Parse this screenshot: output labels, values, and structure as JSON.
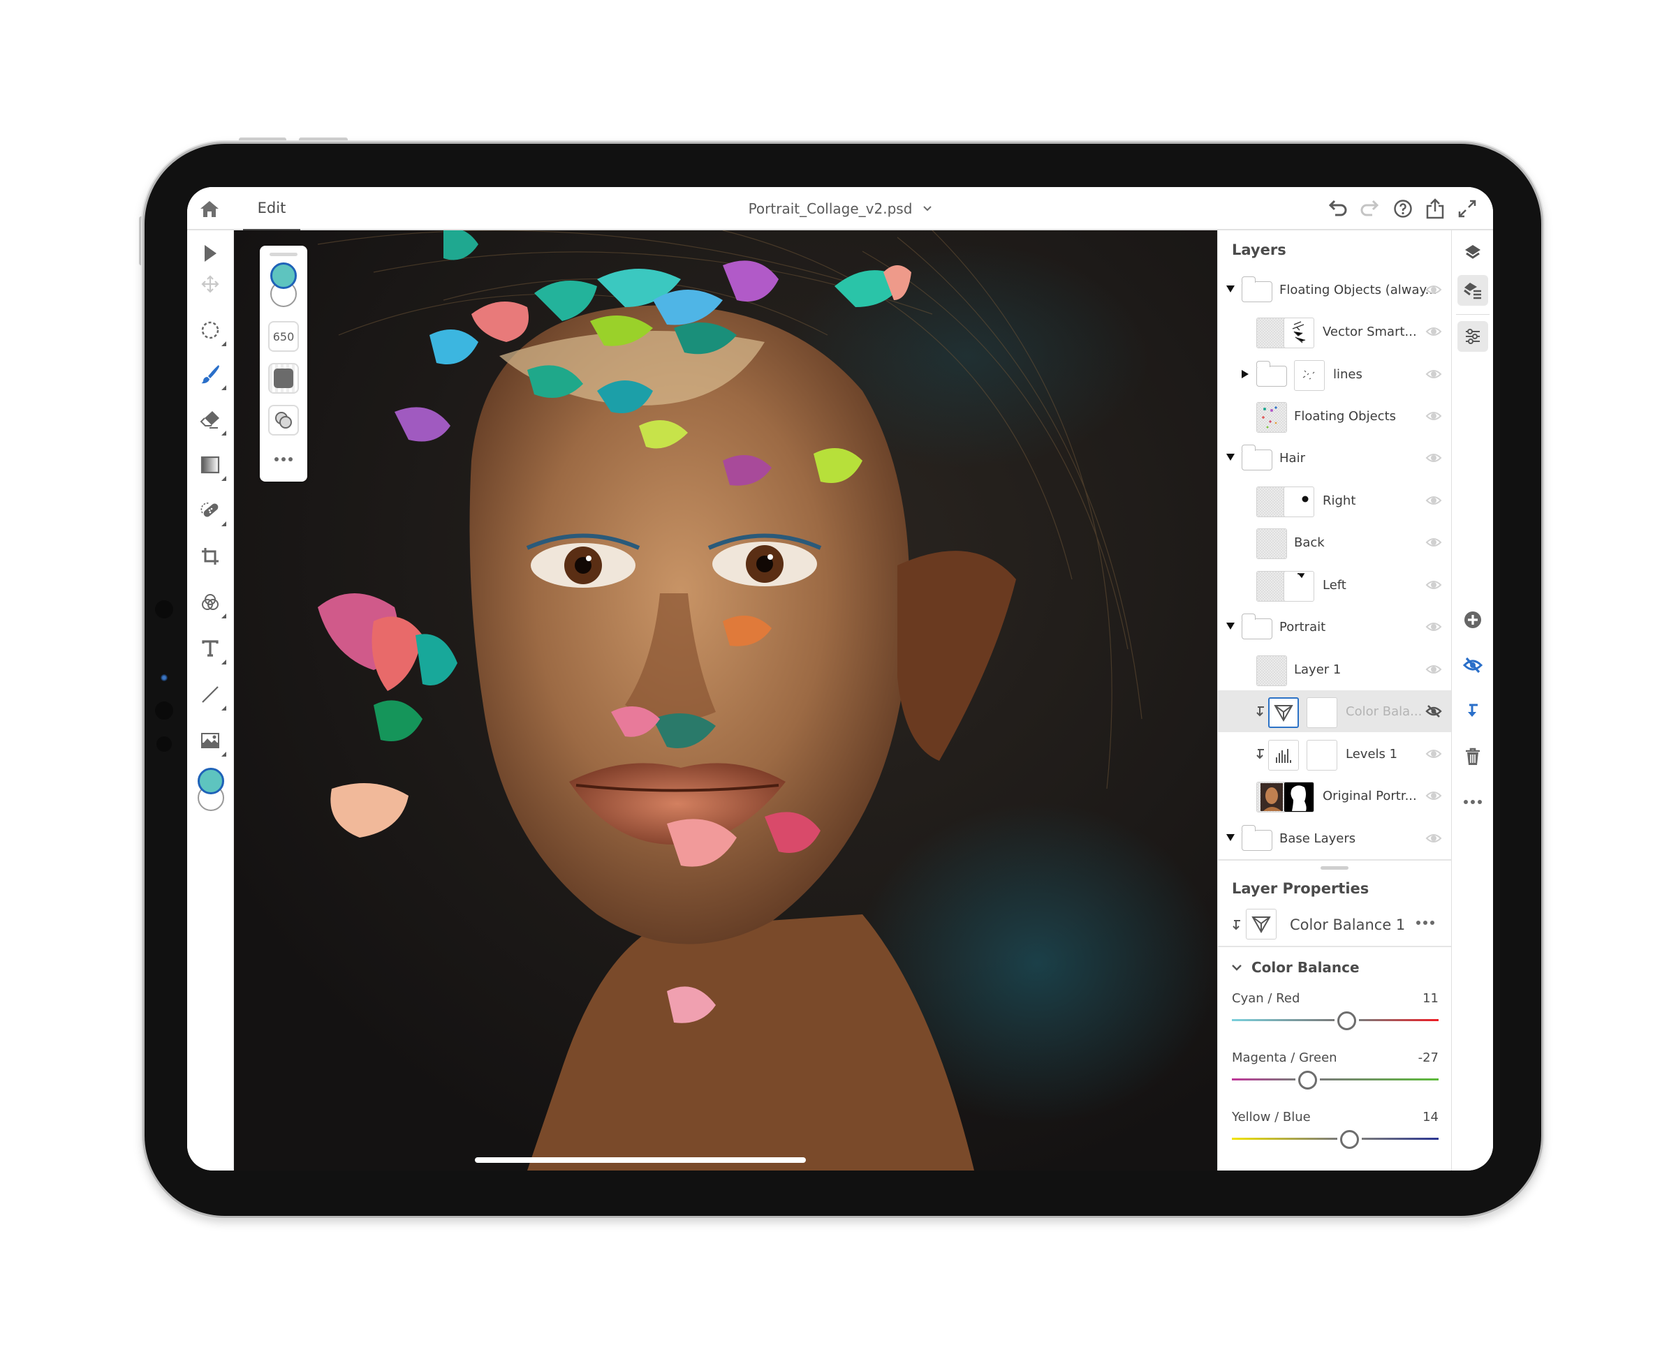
{
  "header": {
    "home_icon": "home-icon",
    "tab_label": "Edit",
    "document_title": "Portrait_Collage_v2.psd",
    "actions": [
      "undo-icon",
      "redo-icon",
      "help-icon",
      "share-icon",
      "fullscreen-icon"
    ]
  },
  "toolbar": {
    "tools": [
      {
        "name": "select",
        "icon": "arrow-pointer-icon"
      },
      {
        "name": "move",
        "icon": "move-icon"
      },
      {
        "name": "lasso-select",
        "icon": "dashed-circle-icon"
      },
      {
        "name": "brush",
        "icon": "brush-icon",
        "active": true
      },
      {
        "name": "eraser",
        "icon": "eraser-icon"
      },
      {
        "name": "gradient",
        "icon": "gradient-icon"
      },
      {
        "name": "healing",
        "icon": "bandage-icon"
      },
      {
        "name": "crop",
        "icon": "crop-icon"
      },
      {
        "name": "adjustments",
        "icon": "color-circles-icon"
      },
      {
        "name": "type",
        "icon": "type-icon"
      },
      {
        "name": "line",
        "icon": "line-icon"
      },
      {
        "name": "place-image",
        "icon": "image-icon"
      }
    ],
    "foreground_color": "#5ec4bf",
    "background_color": "#ffffff"
  },
  "tool_options": {
    "foreground_color": "#5ec4bf",
    "brush_size": "650",
    "brush_hardness_icon": "brush-tip-icon",
    "blend_icon": "blend-circles-icon",
    "more_icon": "more-icon"
  },
  "layers_panel": {
    "title": "Layers",
    "layers": [
      {
        "name": "Floating Objects (alway...",
        "type": "group",
        "expanded": true,
        "depth": 0,
        "visible": true
      },
      {
        "name": "Vector Smart...",
        "type": "smart-object",
        "depth": 1,
        "visible": true
      },
      {
        "name": "lines",
        "type": "group",
        "expanded": false,
        "depth": 1,
        "visible": true
      },
      {
        "name": "Floating Objects",
        "type": "pixel",
        "depth": 1,
        "visible": true
      },
      {
        "name": "Hair",
        "type": "group",
        "expanded": true,
        "depth": 0,
        "visible": true
      },
      {
        "name": "Right",
        "type": "pixel-with-mask",
        "depth": 1,
        "visible": true
      },
      {
        "name": "Back",
        "type": "pixel",
        "depth": 1,
        "visible": true
      },
      {
        "name": "Left",
        "type": "pixel-with-mask",
        "depth": 1,
        "visible": true
      },
      {
        "name": "Portrait",
        "type": "group",
        "expanded": true,
        "depth": 0,
        "visible": true
      },
      {
        "name": "Layer 1",
        "type": "pixel",
        "depth": 1,
        "visible": true
      },
      {
        "name": "Color Bala...",
        "type": "adjustment-color-balance",
        "depth": 1,
        "visible": false,
        "selected": true,
        "clipped": true
      },
      {
        "name": "Levels 1",
        "type": "adjustment-levels",
        "depth": 1,
        "visible": true,
        "clipped": true
      },
      {
        "name": "Original Portr...",
        "type": "pixel-with-mask",
        "depth": 1,
        "visible": true
      },
      {
        "name": "Base Layers",
        "type": "group",
        "expanded": true,
        "depth": 0,
        "visible": true
      }
    ]
  },
  "layer_properties": {
    "title": "Layer Properties",
    "layer_name": "Color Balance 1",
    "section_title": "Color Balance",
    "sliders": [
      {
        "label": "Cyan / Red",
        "value": 11,
        "min": -100,
        "max": 100,
        "left_color": "#79d0dc",
        "right_color": "#ee1c24"
      },
      {
        "label": "Magenta / Green",
        "value": -27,
        "min": -100,
        "max": 100,
        "left_color": "#c0379a",
        "right_color": "#5cbb3a"
      },
      {
        "label": "Yellow / Blue",
        "value": 14,
        "min": -100,
        "max": 100,
        "left_color": "#f2e400",
        "right_color": "#2a3592"
      }
    ]
  },
  "right_column": {
    "icons": [
      "layers-icon",
      "layer-list-icon",
      "adjustments-sliders-icon",
      "add-layer-icon",
      "toggle-visibility-icon",
      "clip-layer-icon",
      "delete-icon",
      "more-icon"
    ]
  },
  "colors": {
    "accent_blue": "#2c72c6",
    "panel_bg": "#ffffff",
    "selected_row": "#e7e7e7",
    "canvas_bg": "#171514"
  }
}
